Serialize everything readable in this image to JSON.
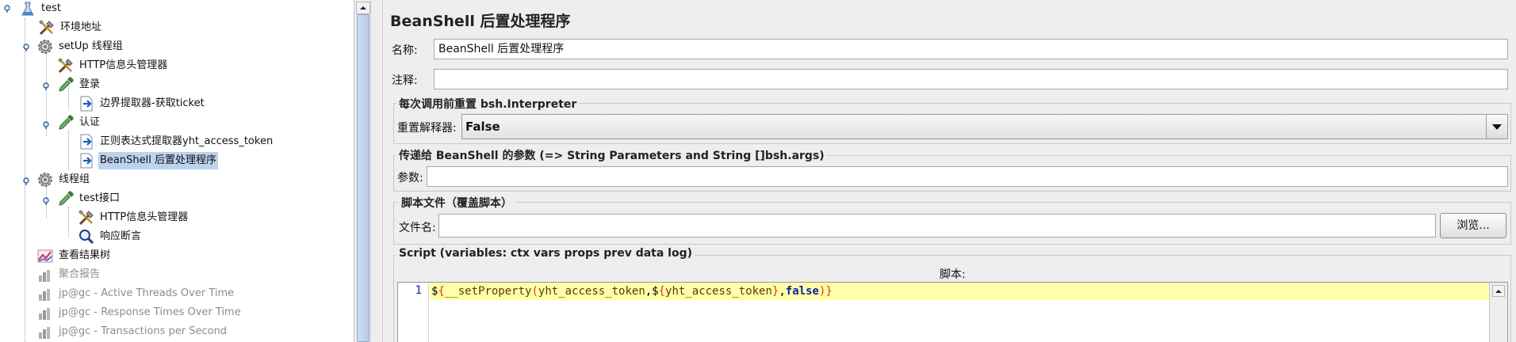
{
  "tree": {
    "nodes": [
      {
        "label": "test",
        "icon": "test-plan-icon"
      },
      {
        "label": "环境地址",
        "icon": "config-tools-icon"
      },
      {
        "label": "setUp 线程组",
        "icon": "thread-group-gear-icon"
      },
      {
        "label": "HTTP信息头管理器",
        "icon": "config-tools-icon"
      },
      {
        "label": "登录",
        "icon": "http-sampler-pipette-icon"
      },
      {
        "label": "边界提取器-获取ticket",
        "icon": "post-processor-icon"
      },
      {
        "label": "认证",
        "icon": "http-sampler-pipette-icon"
      },
      {
        "label": "正则表达式提取器yht_access_token",
        "icon": "post-processor-icon"
      },
      {
        "label": "BeanShell 后置处理程序",
        "icon": "post-processor-icon"
      },
      {
        "label": "线程组",
        "icon": "thread-group-gear-icon"
      },
      {
        "label": "test接口",
        "icon": "http-sampler-pipette-icon"
      },
      {
        "label": "HTTP信息头管理器",
        "icon": "config-tools-icon"
      },
      {
        "label": "响应断言",
        "icon": "magnifier-icon"
      },
      {
        "label": "查看结果树",
        "icon": "listener-graph-icon"
      },
      {
        "label": "聚合报告",
        "icon": "listener-bars-icon"
      },
      {
        "label": "jp@gc - Active Threads Over Time",
        "icon": "listener-bars-icon"
      },
      {
        "label": "jp@gc - Response Times Over Time",
        "icon": "listener-bars-icon"
      },
      {
        "label": "jp@gc - Transactions per Second",
        "icon": "listener-bars-icon"
      }
    ]
  },
  "panel": {
    "title": "BeanShell 后置处理程序",
    "name_label": "名称:",
    "name_value": "BeanShell 后置处理程序",
    "comment_label": "注释:",
    "comment_value": "",
    "reset_group_title": "每次调用前重置 bsh.Interpreter",
    "reset_label": "重置解释器:",
    "reset_value": "False",
    "params_group_title": "传递给 BeanShell 的参数 (=> String Parameters and String []bsh.args)",
    "params_label": "参数:",
    "params_value": "",
    "file_group_title": "脚本文件（覆盖脚本）",
    "file_label": "文件名:",
    "file_value": "",
    "browse_label": "浏览...",
    "script_group_title": "Script (variables: ctx vars props prev data log)",
    "script_caption": "脚本:",
    "script_line_number": "1",
    "script_tokens": {
      "t1": "$",
      "t2": "{",
      "t3": "__setProperty",
      "t4": "(",
      "t5": "yht_access_token",
      "t6": ",$",
      "t7": "{",
      "t8": "yht_access_token",
      "t9": "}",
      "t10": ",",
      "t11": "false",
      "t12": ")",
      "t13": "}"
    }
  },
  "colors": {
    "selection": "#bcd2ee",
    "editor_line_highlight": "#ffffaa",
    "keyword": "#0b1ea8",
    "brace": "#e03f00"
  }
}
